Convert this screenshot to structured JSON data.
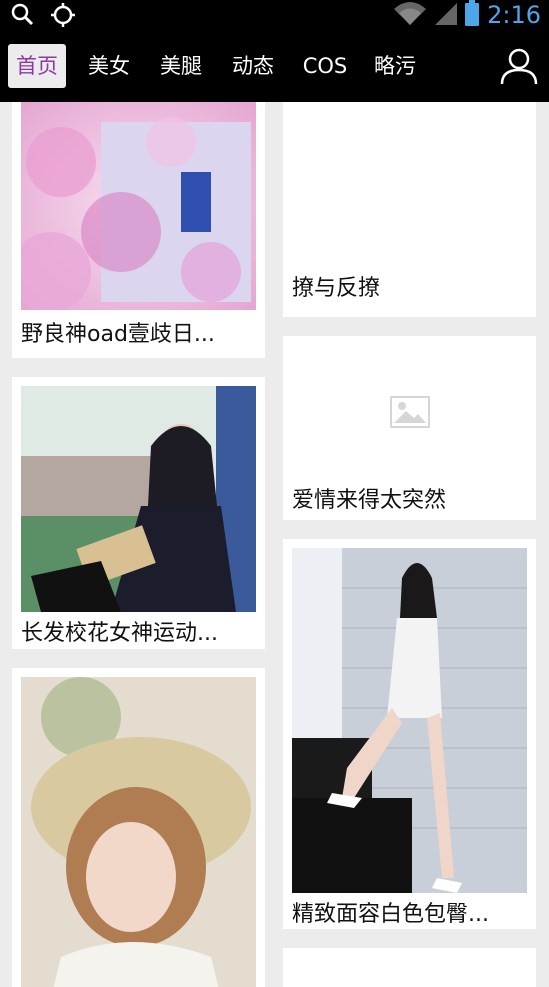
{
  "status_bar": {
    "time": "2:16",
    "icons": [
      "search-icon",
      "gps-icon",
      "wifi-icon",
      "signal-icon",
      "battery-icon"
    ]
  },
  "nav": {
    "tabs": [
      {
        "label": "首页",
        "active": true
      },
      {
        "label": "美女",
        "active": false
      },
      {
        "label": "美腿",
        "active": false
      },
      {
        "label": "动态",
        "active": false
      },
      {
        "label": "COS",
        "active": false
      },
      {
        "label": "略污",
        "active": false
      }
    ],
    "profile_icon": "user-icon",
    "active_color": "#8b3aa6"
  },
  "feed": {
    "left": [
      {
        "caption": "野良神oad壹歧日..."
      },
      {
        "caption": "长发校花女神运动..."
      },
      {
        "caption": ""
      }
    ],
    "right": [
      {
        "caption": "撩与反撩"
      },
      {
        "caption": "爱情来得太突然"
      },
      {
        "caption": "精致面容白色包臀..."
      },
      {
        "caption": ""
      }
    ]
  }
}
